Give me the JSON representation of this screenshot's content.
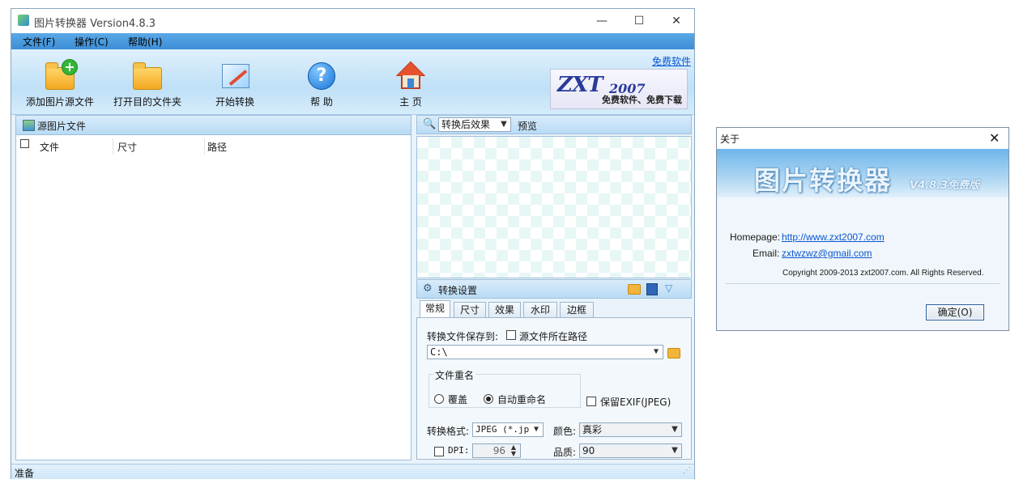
{
  "main": {
    "title": "图片转换器 Version4.8.3",
    "menu": [
      "文件(F)",
      "操作(C)",
      "帮助(H)"
    ],
    "toolbar": [
      {
        "label": "添加图片源文件",
        "icon": "add-folder-icon"
      },
      {
        "label": "打开目的文件夹",
        "icon": "folder-icon"
      },
      {
        "label": "开始转换",
        "icon": "magic-wand-icon"
      },
      {
        "label": "帮 助",
        "icon": "help-icon"
      },
      {
        "label": "主 页",
        "icon": "home-icon"
      }
    ],
    "free_software_link": "免费软件",
    "logo": {
      "text": "ZXT",
      "year": "2007",
      "slogan": "免费软件、免费下载"
    },
    "source_panel": {
      "title": "源图片文件",
      "columns": [
        "文件",
        "尺寸",
        "路径"
      ]
    },
    "preview_panel": {
      "mode_select": "转换后效果",
      "title": "预览"
    },
    "settings": {
      "title": "转换设置",
      "tabs": [
        "常规",
        "尺寸",
        "效果",
        "水印",
        "边框"
      ],
      "active_tab": 0,
      "save_to_label": "转换文件保存到:",
      "source_path_checkbox": "源文件所在路径",
      "save_path": "C:\\",
      "rename_group": "文件重名",
      "overwrite": "覆盖",
      "auto_rename": "自动重命名",
      "keep_exif": "保留EXIF(JPEG)",
      "format_label": "转换格式:",
      "format_value": "JPEG (*.jpg",
      "color_label": "颜色:",
      "color_value": "真彩",
      "dpi_label": "DPI:",
      "dpi_value": "96",
      "quality_label": "品质:",
      "quality_value": "90"
    },
    "status": "准备"
  },
  "about": {
    "title": "关于",
    "banner_title": "图片转换器",
    "banner_version": "V4.8.3免费版",
    "homepage_label": "Homepage:",
    "homepage_url": "http://www.zxt2007.com",
    "email_label": "Email:",
    "email": "zxtwzwz@gmail.com",
    "copyright": "Copyright 2009-2013 zxt2007.com. All Rights Reserved.",
    "ok_button": "确定(O)"
  },
  "colors": {
    "menubar": "#3d8ed6",
    "link": "#0b57d0",
    "panel_border": "#9fbfda"
  }
}
